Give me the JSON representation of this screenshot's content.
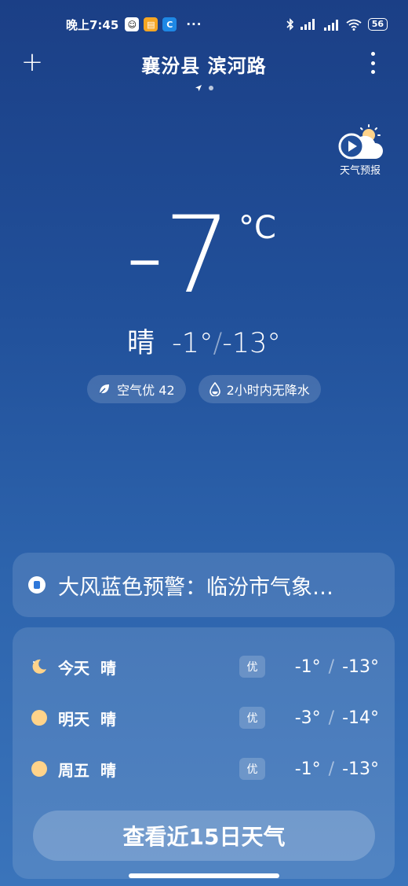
{
  "status_bar": {
    "time": "晚上7:45",
    "more": "···",
    "battery": "56",
    "icons": [
      "qq-icon",
      "files-icon",
      "app-icon",
      "bluetooth-icon",
      "signal-icon",
      "signal-hd-icon",
      "wifi-icon",
      "battery-icon"
    ]
  },
  "header": {
    "add_icon": "+",
    "location": "襄汾县 滨河路"
  },
  "forecast_video": {
    "label": "天气预报"
  },
  "current": {
    "temp": "-7",
    "unit": "°C",
    "condition": "晴",
    "high": "-1°",
    "separator": "/",
    "low": "-13°"
  },
  "chips": {
    "air": "空气优 42",
    "precip": "2小时内无降水"
  },
  "alert": {
    "text": "大风蓝色预警：临汾市气象…"
  },
  "daily": [
    {
      "name": "今天",
      "cond": "晴",
      "aqi": "优",
      "high": "-1°",
      "sep": "/",
      "low": "-13°",
      "icon": "moon-icon"
    },
    {
      "name": "明天",
      "cond": "晴",
      "aqi": "优",
      "high": "-3°",
      "sep": "/",
      "low": "-14°",
      "icon": "sun-icon"
    },
    {
      "name": "周五",
      "cond": "晴",
      "aqi": "优",
      "high": "-1°",
      "sep": "/",
      "low": "-13°",
      "icon": "sun-icon"
    }
  ],
  "fifteen_day_button": "查看近15日天气",
  "colors": {
    "background_top": "#1b3f86",
    "background_bottom": "#3a74bb",
    "sun": "#ffd38a",
    "alert_accent": "#2f78d9"
  }
}
